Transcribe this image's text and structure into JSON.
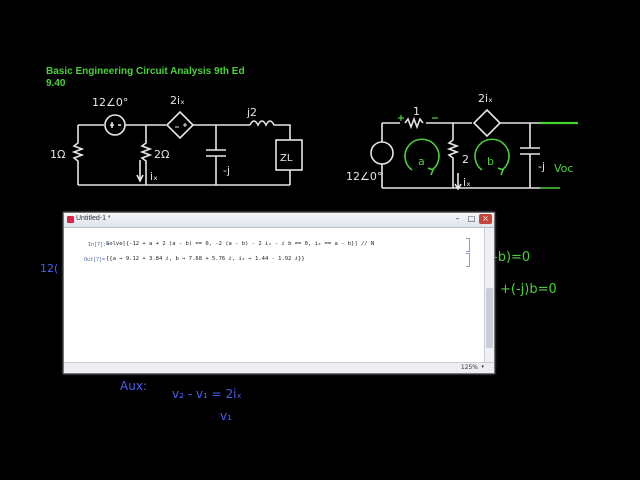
{
  "header": {
    "book_title": "Basic Engineering Circuit Analysis 9th Ed",
    "problem_number": "9.40"
  },
  "left_circuit": {
    "source_label": "12∠0°",
    "dep_source_label": "2iₓ",
    "inductor_label": "j2",
    "resistor1_label": "1Ω",
    "resistor2_label": "2Ω",
    "capacitor_label": "-j",
    "current_label": "iₓ",
    "load_label": "ZL"
  },
  "right_circuit": {
    "resistor_label": "1",
    "dep_source_label": "2iₓ",
    "mid_resistor_label": "2",
    "capacitor_label": "-j",
    "source_label": "12∠0°",
    "mesh_a": "a",
    "mesh_b": "b",
    "voc_label": "Voc",
    "current_label": "iₓ"
  },
  "side_equations": {
    "eq1": "-b)=0",
    "eq2": "+(-j)b=0",
    "left_fragment": "12("
  },
  "aux_notes": {
    "aux_label": "Aux:",
    "aux_eq": "v₂ - v₁ = 2iₓ",
    "aux_line2": "v₁"
  },
  "window": {
    "title": "Untitled-1 *",
    "minimize": "–",
    "maximize": "□",
    "close": "×",
    "input_label": "In[7]:=",
    "input_code": "Solve[{-12 + a + 2 (a - b) == 0, -2 (a - b) - 2 iₓ - ⅈ b == 0, iₓ == a - b}] // N",
    "output_label": "Out[7]=",
    "output_code": "{{a → 9.12 + 3.84 ⅈ, b → 7.68 + 5.76 ⅈ, iₓ → 1.44 - 1.92 ⅈ}}",
    "zoom_level": "125%"
  },
  "colors": {
    "chalk_white": "#e8e8e8",
    "chalk_green": "#4bd03a",
    "chalk_blue": "#4a5ff0",
    "title_green": "#4bd03a"
  }
}
